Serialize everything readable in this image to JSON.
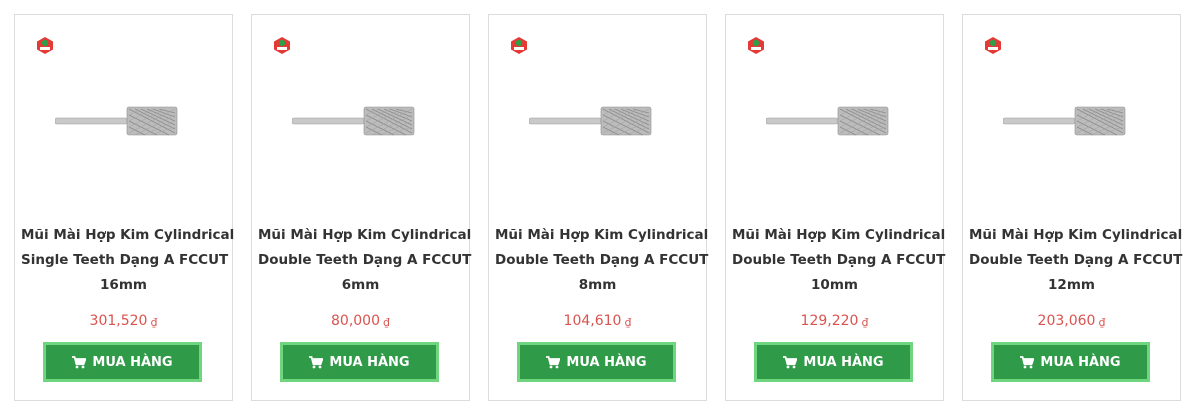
{
  "colors": {
    "price": "#d9534f",
    "button_bg": "#2f9a47",
    "button_border": "#6fd57f",
    "title": "#333333",
    "card_border": "#dcdcdc"
  },
  "icons": {
    "badge": "gisi-tools-logo-icon",
    "cart": "shopping-cart-icon"
  },
  "currency_symbol": "₫",
  "buy_label": "MUA HÀNG",
  "products": [
    {
      "title_lines": [
        "Mũi Mài Hợp Kim Cylindrical",
        "Single Teeth Dạng A FCCUT",
        "16mm"
      ],
      "price": "301,520"
    },
    {
      "title_lines": [
        "Mũi Mài Hợp Kim Cylindrical",
        "Double Teeth Dạng A FCCUT",
        "6mm"
      ],
      "price": "80,000"
    },
    {
      "title_lines": [
        "Mũi Mài Hợp Kim Cylindrical",
        "Double Teeth Dạng A FCCUT",
        "8mm"
      ],
      "price": "104,610"
    },
    {
      "title_lines": [
        "Mũi Mài Hợp Kim Cylindrical",
        "Double Teeth Dạng A FCCUT",
        "10mm"
      ],
      "price": "129,220"
    },
    {
      "title_lines": [
        "Mũi Mài Hợp Kim Cylindrical",
        "Double Teeth Dạng A FCCUT",
        "12mm"
      ],
      "price": "203,060"
    }
  ]
}
